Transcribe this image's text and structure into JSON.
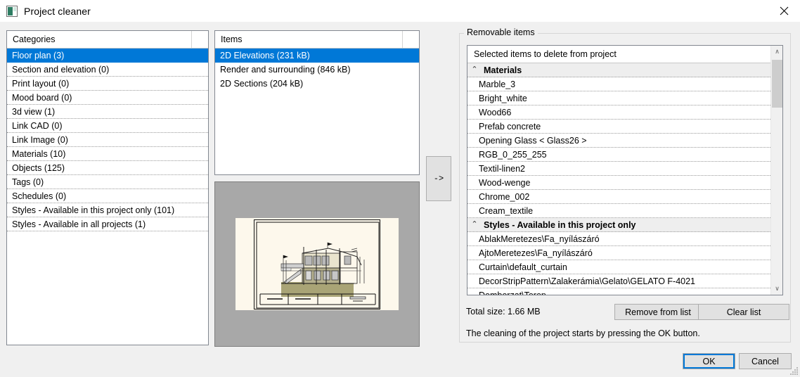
{
  "window": {
    "title": "Project cleaner",
    "icon": "project-cleaner-icon",
    "close_label": "✕"
  },
  "categories": {
    "header": "Categories",
    "items": [
      {
        "label": "Floor plan (3)",
        "selected": true
      },
      {
        "label": "Section and elevation (0)",
        "selected": false
      },
      {
        "label": "Print layout (0)",
        "selected": false
      },
      {
        "label": "Mood board (0)",
        "selected": false
      },
      {
        "label": "3d view (1)",
        "selected": false
      },
      {
        "label": "Link CAD (0)",
        "selected": false
      },
      {
        "label": "Link Image (0)",
        "selected": false
      },
      {
        "label": "Materials (10)",
        "selected": false
      },
      {
        "label": "Objects (125)",
        "selected": false
      },
      {
        "label": "Tags (0)",
        "selected": false
      },
      {
        "label": "Schedules (0)",
        "selected": false
      },
      {
        "label": "Styles - Available in this project only (101)",
        "selected": false
      },
      {
        "label": "Styles - Available in all projects (1)",
        "selected": false
      }
    ]
  },
  "items": {
    "header": "Items",
    "entries": [
      {
        "label": "2D Elevations (231 kB)",
        "selected": true
      },
      {
        "label": "Render and surrounding (846 kB)",
        "selected": false
      },
      {
        "label": "2D Sections (204 kB)",
        "selected": false
      }
    ]
  },
  "preview": {
    "caption": "2D elevation drawing preview"
  },
  "transfer": {
    "arrow_label": "->"
  },
  "removable": {
    "group_label": "Removable items",
    "list_header": "Selected items to delete from project",
    "rows": [
      {
        "label": "Materials",
        "type": "group"
      },
      {
        "label": "Marble_3",
        "type": "item"
      },
      {
        "label": "Bright_white",
        "type": "item"
      },
      {
        "label": "Wood66",
        "type": "item"
      },
      {
        "label": "Prefab concrete",
        "type": "item"
      },
      {
        "label": "Opening Glass < Glass26 >",
        "type": "item"
      },
      {
        "label": "RGB_0_255_255",
        "type": "item"
      },
      {
        "label": "Textil-linen2",
        "type": "item"
      },
      {
        "label": "Wood-wenge",
        "type": "item"
      },
      {
        "label": "Chrome_002",
        "type": "item"
      },
      {
        "label": "Cream_textile",
        "type": "item"
      },
      {
        "label": "Styles - Available in this project only",
        "type": "group"
      },
      {
        "label": "AblakMeretezes\\Fa_nyílászáró",
        "type": "item"
      },
      {
        "label": "AjtoMeretezes\\Fa_nyílászáró",
        "type": "item"
      },
      {
        "label": "Curtain\\default_curtain",
        "type": "item"
      },
      {
        "label": "DecorStripPattern\\Zalakerámia\\Gelato\\GELATO F-4021",
        "type": "item"
      },
      {
        "label": "Domborzat\\Terep",
        "type": "item"
      }
    ],
    "scroll": {
      "up_glyph": "∧",
      "down_glyph": "∨"
    },
    "total_size": "Total size: 1.66 MB",
    "remove_from_list": "Remove from list",
    "clear_list": "Clear list",
    "hint": "The cleaning of the project starts by pressing the OK button."
  },
  "footer": {
    "ok": "OK",
    "cancel": "Cancel"
  },
  "colors": {
    "selection_blue": "#0078d7",
    "dialog_bg": "#f0f0f0",
    "button_face": "#e1e1e1",
    "preview_bg": "#a8a8a8"
  }
}
